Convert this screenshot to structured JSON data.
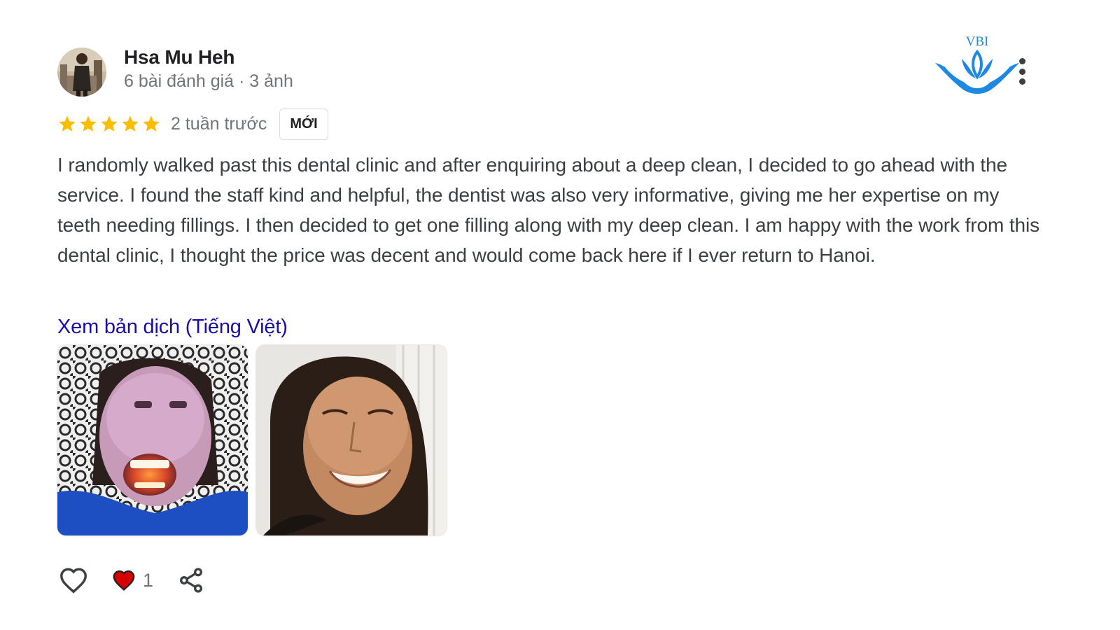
{
  "review": {
    "author": {
      "name": "Hsa Mu Heh",
      "meta": "6 bài đánh giá · 3 ảnh",
      "avatar_icon": "user-avatar-photo"
    },
    "brand": {
      "logo_text": "VBI",
      "logo_color": "#1e88e5",
      "logo_icon": "lotus-logo-icon"
    },
    "menu_icon": "more-vert-icon",
    "rating": {
      "stars": 5,
      "max_stars": 5,
      "star_color": "#fbbc04",
      "time": "2 tuần trước",
      "badge": "MỚI"
    },
    "text": "I randomly walked past this dental clinic and after enquiring about a deep clean, I decided to go ahead with the service. I found the staff kind and helpful, the dentist was also very informative, giving me her expertise on my teeth needing fillings. I then decided to get one filling along with my deep clean. I am happy with the work from this dental clinic, I thought the price was decent and would come back here if I ever return to Hanoi.",
    "translate_link": "Xem bản dịch (Tiếng Việt)",
    "link_color": "#1a0dab",
    "photos": [
      {
        "icon": "review-photo-whitening"
      },
      {
        "icon": "review-photo-smile"
      }
    ],
    "actions": {
      "like_icon": "heart-outline-icon",
      "reaction_icon": "heart-filled-icon",
      "reaction_color": "#d50000",
      "reaction_count": "1",
      "share_icon": "share-icon"
    }
  }
}
